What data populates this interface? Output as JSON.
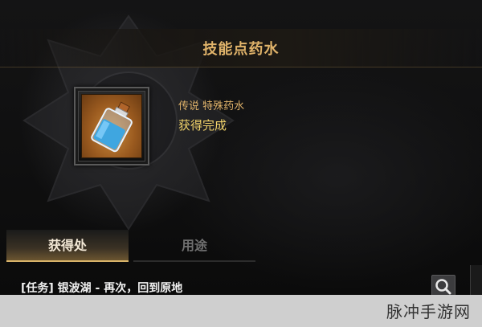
{
  "window": {
    "title": "技能点药水"
  },
  "item": {
    "icon": "potion-bottle-icon",
    "type_label": "传说 特殊药水",
    "status_label": "获得完成"
  },
  "tabs": [
    {
      "label": "获得处",
      "active": true
    },
    {
      "label": "用途",
      "active": false
    }
  ],
  "task": {
    "text": "[任务] 银波湖 - 再次，回到原地",
    "action_icon": "search-icon"
  },
  "watermark": {
    "text": "脉冲手游网"
  },
  "colors": {
    "accent_gold": "#e0b36a",
    "status_yellow": "#f0d26a"
  }
}
